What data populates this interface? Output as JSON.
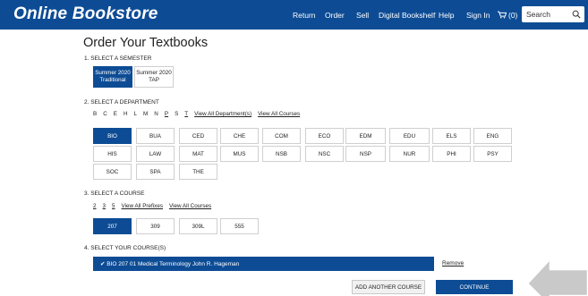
{
  "header": {
    "logo": "Online Bookstore",
    "nav": [
      "Return",
      "Order",
      "Sell",
      "Digital Bookshelf",
      "Help",
      "Sign In"
    ],
    "cart_label": "(0)",
    "search_placeholder": "Search"
  },
  "page_title": "Order Your Textbooks",
  "semester": {
    "label": "1. SELECT A SEMESTER",
    "options": [
      {
        "line1": "Summer 2020",
        "line2": "Traditional"
      },
      {
        "line1": "Summer 2020",
        "line2": "TAP"
      }
    ]
  },
  "department": {
    "label": "2. SELECT A DEPARTMENT",
    "letters": [
      "B",
      "C",
      "E",
      "H",
      "L",
      "M",
      "N",
      "P",
      "S",
      "T"
    ],
    "view_all_departments": "View All Department(s)",
    "view_all_courses": "View All Courses",
    "codes": [
      "BIO",
      "BUA",
      "CED",
      "CHE",
      "COM",
      "ECO",
      "EDM",
      "EDU",
      "ELS",
      "ENG",
      "HIS",
      "LAW",
      "MAT",
      "MUS",
      "NSB",
      "NSC",
      "NSP",
      "NUR",
      "PHI",
      "PSY",
      "SOC",
      "SPA",
      "THE"
    ]
  },
  "course": {
    "label": "3. SELECT A COURSE",
    "prefixes": [
      "2",
      "3",
      "5"
    ],
    "view_all_prefixes": "View All Prefixes",
    "view_all_courses": "View All Courses",
    "numbers": [
      "207",
      "309",
      "309L",
      "555"
    ]
  },
  "your_courses": {
    "label": "4. SELECT YOUR COURSE(S)",
    "selected": "✔ BIO 207 01  Medical Terminology John R. Hageman",
    "remove": "Remove"
  },
  "actions": {
    "add_another": "ADD ANOTHER COURSE",
    "continue": "CONTINUE"
  },
  "colors": {
    "brand_blue": "#0d4c95",
    "arrow_gray": "#c9c9c9"
  }
}
